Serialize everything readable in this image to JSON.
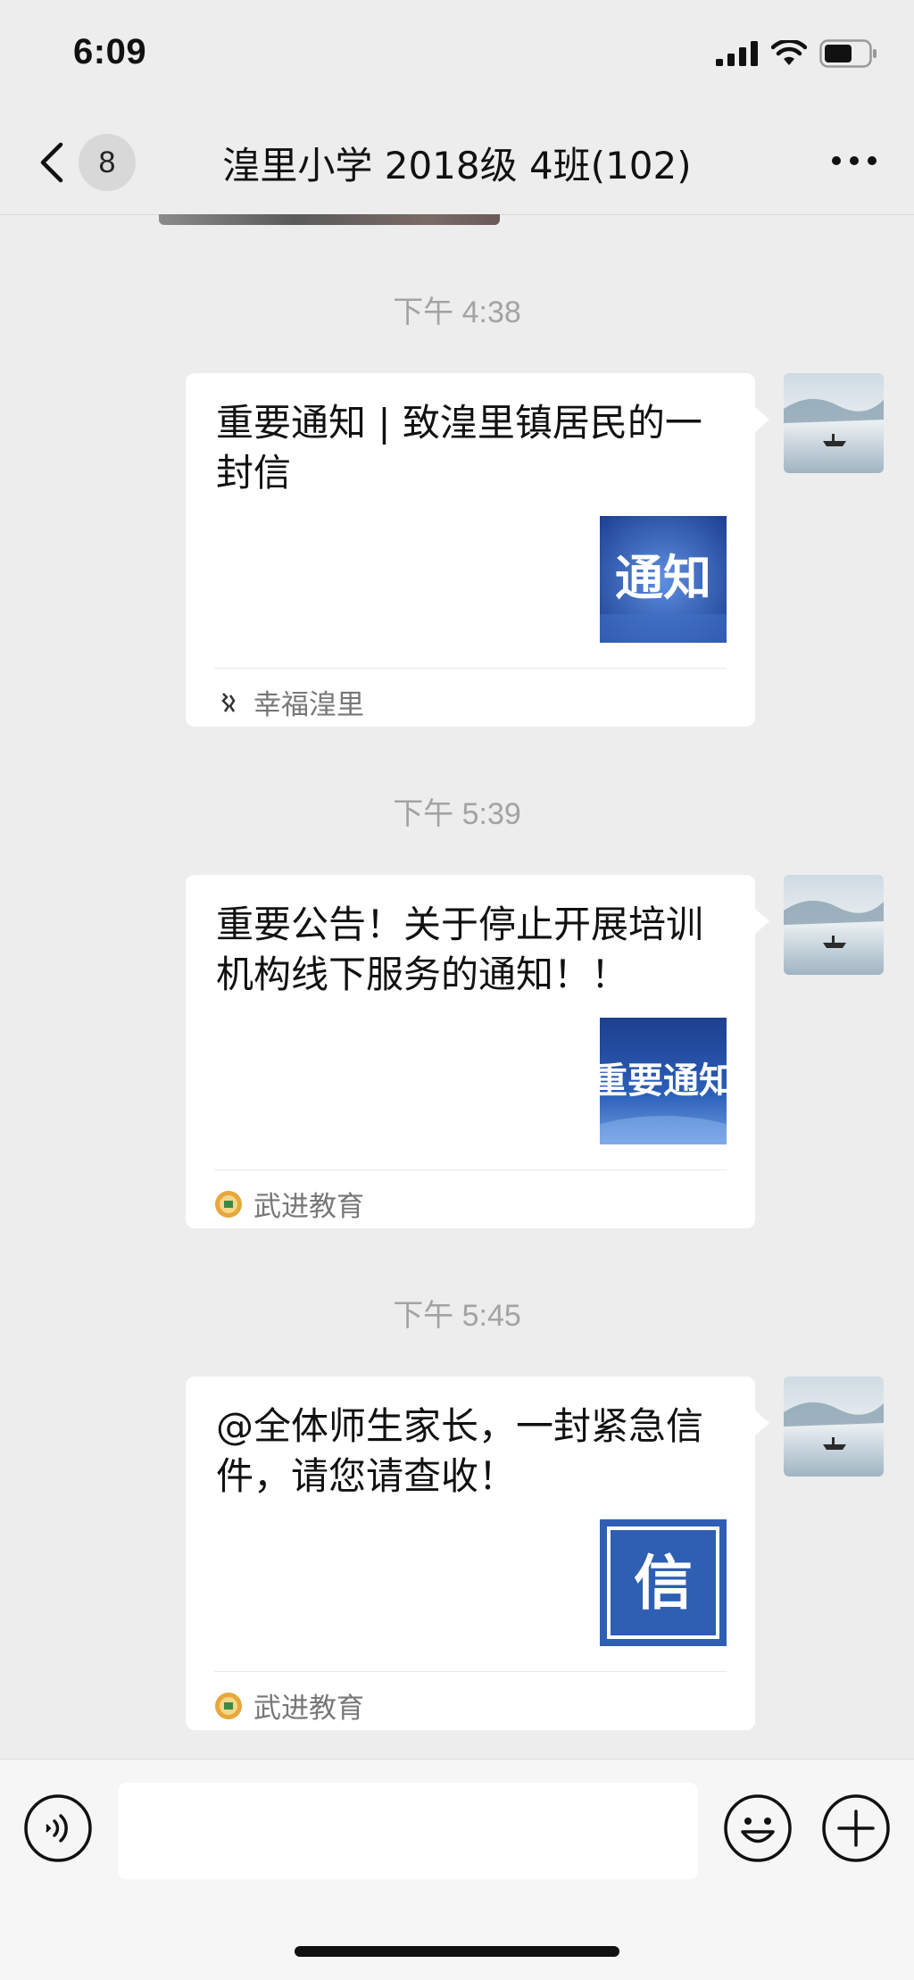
{
  "status_bar": {
    "time": "6:09"
  },
  "nav": {
    "unread_count": "8",
    "title": "湟里小学 2018级 4班(102)"
  },
  "messages": [
    {
      "timestamp": "下午 4:38",
      "title": "重要通知 | 致湟里镇居民的一封信",
      "thumb_text": "通知",
      "source": "幸福湟里"
    },
    {
      "timestamp": "下午 5:39",
      "title": "重要公告！关于停止开展培训机构线下服务的通知！！",
      "thumb_text": "重要通知",
      "source": "武进教育"
    },
    {
      "timestamp": "下午 5:45",
      "title": "@全体师生家长，一封紧急信件，请您请查收！",
      "thumb_text": "信",
      "source": "武进教育"
    }
  ],
  "input": {
    "value": ""
  },
  "colors": {
    "background": "#ededed",
    "card": "#ffffff",
    "thumb_blue": "#2f5fb3",
    "timestamp": "#a3a3a3"
  },
  "icons": [
    "back-chevron-icon",
    "signal-icon",
    "wifi-icon",
    "battery-icon",
    "more-dots-icon",
    "voice-icon",
    "emoji-icon",
    "plus-icon"
  ]
}
